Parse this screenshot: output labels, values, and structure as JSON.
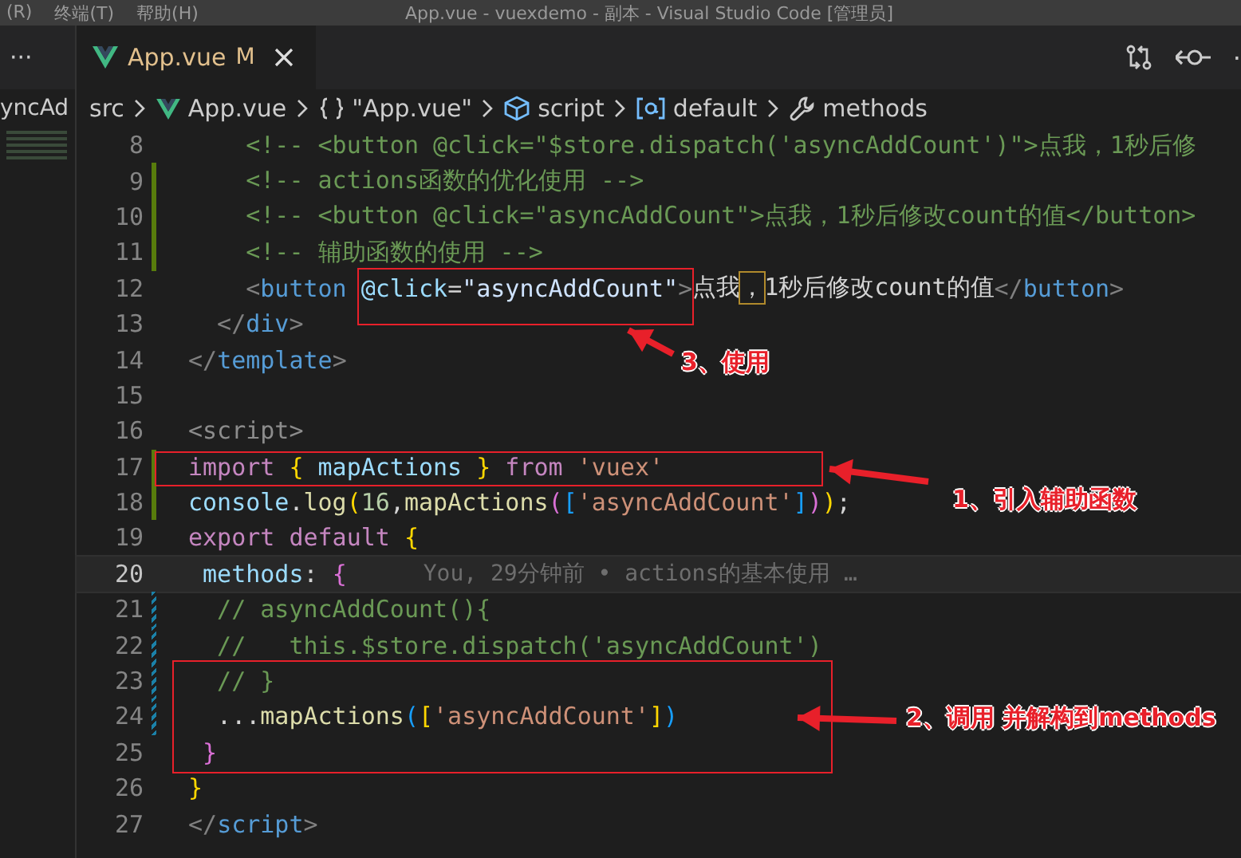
{
  "title_bar": {
    "menu": [
      "(R)",
      "终端(T)",
      "帮助(H)"
    ],
    "title": "App.vue - vuexdemo - 副本 - Visual Studio Code [管理员]"
  },
  "side_panel": {
    "more": "···",
    "breadcrumb": "yncAd"
  },
  "tabs": [
    {
      "label": "App.vue",
      "badge": "M",
      "selected": true
    }
  ],
  "tab_actions": {
    "more": "·"
  },
  "breadcrumbs": [
    {
      "kind": "folder",
      "label": "src"
    },
    {
      "kind": "vue",
      "label": "App.vue"
    },
    {
      "kind": "braces",
      "label": "\"App.vue\""
    },
    {
      "kind": "cube",
      "label": "script"
    },
    {
      "kind": "namespace",
      "label": "default"
    },
    {
      "kind": "wrench",
      "label": "methods"
    }
  ],
  "lines": [
    {
      "number": "8",
      "current": false,
      "git_added": false,
      "git_modified": false,
      "tokens": [
        {
          "kind": "comment",
          "text": "    <!-- <button @click=\"$store.dispatch('asyncAddCount')\">点我，1秒后修"
        }
      ]
    },
    {
      "number": "9",
      "current": false,
      "git_added": true,
      "git_modified": false,
      "tokens": [
        {
          "kind": "comment",
          "text": "    <!-- actions函数的优化使用 -->"
        }
      ]
    },
    {
      "number": "10",
      "current": false,
      "git_added": true,
      "git_modified": false,
      "tokens": [
        {
          "kind": "comment",
          "text": "    <!-- <button @click=\"asyncAddCount\">点我，1秒后修改count的值</button>"
        }
      ]
    },
    {
      "number": "11",
      "current": false,
      "git_added": true,
      "git_modified": false,
      "tokens": [
        {
          "kind": "comment",
          "text": "    <!-- 辅助函数的使用 -->"
        }
      ]
    },
    {
      "number": "12",
      "current": false,
      "git_added": false,
      "git_modified": false,
      "tokens": [
        {
          "kind": "punct",
          "text": "    <"
        },
        {
          "kind": "tag",
          "text": "button"
        },
        {
          "kind": "attr",
          "text": " @click"
        },
        {
          "kind": "plain",
          "text": "="
        },
        {
          "kind": "value",
          "text": "\"asyncAddCount\""
        },
        {
          "kind": "punct",
          "text": ">"
        },
        {
          "kind": "plain",
          "text": "点我"
        },
        {
          "kind": "match",
          "text": "，"
        },
        {
          "kind": "plain",
          "text": "1秒后修改count的值"
        },
        {
          "kind": "punct",
          "text": "</"
        },
        {
          "kind": "tag",
          "text": "button"
        },
        {
          "kind": "punct",
          "text": ">"
        }
      ]
    },
    {
      "number": "13",
      "current": false,
      "git_added": false,
      "git_modified": false,
      "tokens": [
        {
          "kind": "punct",
          "text": "  </"
        },
        {
          "kind": "tag",
          "text": "div"
        },
        {
          "kind": "punct",
          "text": ">"
        }
      ]
    },
    {
      "number": "14",
      "current": false,
      "git_added": false,
      "git_modified": false,
      "tokens": [
        {
          "kind": "punct",
          "text": "</"
        },
        {
          "kind": "tag",
          "text": "template"
        },
        {
          "kind": "punct",
          "text": ">"
        }
      ]
    },
    {
      "number": "15",
      "current": false,
      "git_added": false,
      "git_modified": false
    },
    {
      "number": "16",
      "current": false,
      "git_added": false,
      "git_modified": false,
      "tokens": [
        {
          "kind": "dim",
          "text": "<script>"
        }
      ]
    },
    {
      "number": "17",
      "current": false,
      "git_added": true,
      "git_modified": false,
      "tokens": [
        {
          "kind": "keyword",
          "text": "import"
        },
        {
          "kind": "brace1",
          "text": " {"
        },
        {
          "kind": "variable",
          "text": " mapActions "
        },
        {
          "kind": "brace1",
          "text": "}"
        },
        {
          "kind": "keyword",
          "text": " from"
        },
        {
          "kind": "string",
          "text": " 'vuex'"
        }
      ]
    },
    {
      "number": "18",
      "current": false,
      "git_added": true,
      "git_modified": false,
      "tokens": [
        {
          "kind": "variable",
          "text": "console"
        },
        {
          "kind": "plain",
          "text": "."
        },
        {
          "kind": "function",
          "text": "log"
        },
        {
          "kind": "brace1",
          "text": "("
        },
        {
          "kind": "number",
          "text": "16"
        },
        {
          "kind": "plain",
          "text": ","
        },
        {
          "kind": "function",
          "text": "mapActions"
        },
        {
          "kind": "brace2",
          "text": "("
        },
        {
          "kind": "brace3",
          "text": "["
        },
        {
          "kind": "string",
          "text": "'asyncAddCount'"
        },
        {
          "kind": "brace3",
          "text": "]"
        },
        {
          "kind": "brace2",
          "text": ")"
        },
        {
          "kind": "brace1",
          "text": ")"
        },
        {
          "kind": "plain",
          "text": ";"
        }
      ]
    },
    {
      "number": "19",
      "current": false,
      "git_added": false,
      "git_modified": false,
      "tokens": [
        {
          "kind": "keyword",
          "text": "export default"
        },
        {
          "kind": "brace1",
          "text": " {"
        }
      ]
    },
    {
      "number": "20",
      "current": true,
      "git_added": false,
      "git_modified": false,
      "blame": "You, 29分钟前 • actions的基本使用 …",
      "tokens": [
        {
          "kind": "variable",
          "text": " methods"
        },
        {
          "kind": "plain",
          "text": ": "
        },
        {
          "kind": "brace2",
          "text": "{"
        }
      ]
    },
    {
      "number": "21",
      "current": false,
      "git_added": false,
      "git_modified": true,
      "tokens": [
        {
          "kind": "comment",
          "text": "  // asyncAddCount(){"
        }
      ]
    },
    {
      "number": "22",
      "current": false,
      "git_added": false,
      "git_modified": true,
      "tokens": [
        {
          "kind": "comment",
          "text": "  //   this.$store.dispatch('asyncAddCount')"
        }
      ]
    },
    {
      "number": "23",
      "current": false,
      "git_added": false,
      "git_modified": true,
      "tokens": [
        {
          "kind": "comment",
          "text": "  // }"
        }
      ]
    },
    {
      "number": "24",
      "current": false,
      "git_added": false,
      "git_modified": true,
      "tokens": [
        {
          "kind": "plain",
          "text": "  ..."
        },
        {
          "kind": "function",
          "text": "mapActions"
        },
        {
          "kind": "brace3",
          "text": "("
        },
        {
          "kind": "brace1",
          "text": "["
        },
        {
          "kind": "string",
          "text": "'asyncAddCount'"
        },
        {
          "kind": "brace1",
          "text": "]"
        },
        {
          "kind": "brace3",
          "text": ")"
        }
      ]
    },
    {
      "number": "25",
      "current": false,
      "git_added": false,
      "git_modified": false,
      "tokens": [
        {
          "kind": "brace2",
          "text": " }"
        }
      ]
    },
    {
      "number": "26",
      "current": false,
      "git_added": false,
      "git_modified": false,
      "tokens": [
        {
          "kind": "brace1",
          "text": "}"
        }
      ]
    },
    {
      "number": "27",
      "current": false,
      "git_added": false,
      "git_modified": false,
      "tokens": [
        {
          "kind": "punct",
          "text": "</"
        },
        {
          "kind": "tag",
          "text": "script"
        },
        {
          "kind": "punct",
          "text": ">"
        }
      ]
    }
  ],
  "annotations": [
    {
      "label": "3、使用"
    },
    {
      "label": "1、引入辅助函数"
    },
    {
      "label": "2、调用 并解构到methods"
    }
  ]
}
